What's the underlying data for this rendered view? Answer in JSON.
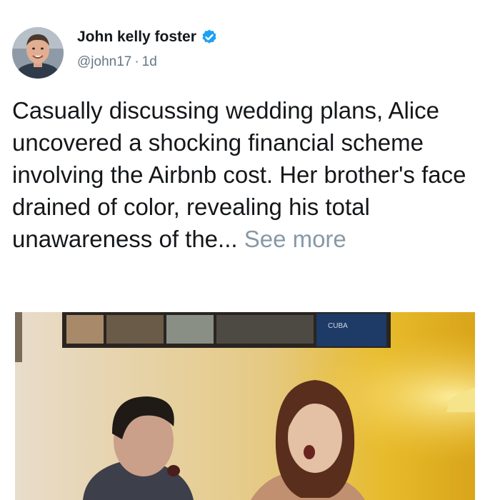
{
  "tweet": {
    "author_name": "John kelly foster",
    "handle": "@john17",
    "separator": "·",
    "timestamp": "1d",
    "text": "Casually discussing wedding plans, Alice uncovered a shocking financial scheme involving the Airbnb cost. Her brother's face drained of color, revealing his total unawareness of the...",
    "see_more_label": "See more",
    "verified": true
  },
  "media": {
    "description_icon": "photo",
    "poster_text": "CUBA"
  },
  "colors": {
    "verified_blue": "#1da1f2",
    "secondary_text": "#657786",
    "link_grey": "#8899a6"
  }
}
